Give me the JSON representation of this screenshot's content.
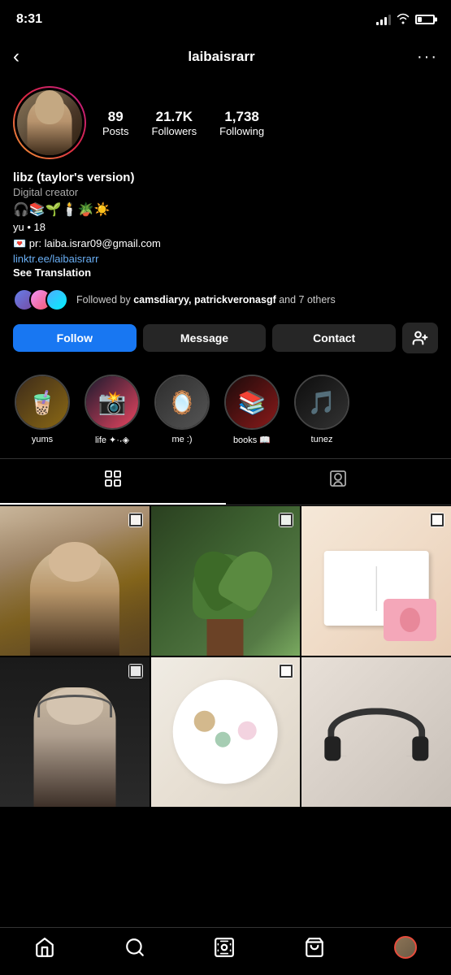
{
  "status": {
    "time": "8:31"
  },
  "nav": {
    "username": "laibaisrarr",
    "back_label": "‹",
    "more_label": "···"
  },
  "profile": {
    "name": "libz (taylor's version)",
    "category": "Digital creator",
    "emojis": "🎧📚🌱🕯️🪴☀️",
    "bio_line1": "yu • 18",
    "bio_line2": "💌 pr: laiba.israr09@gmail.com",
    "bio_link": "linktr.ee/laibaisrarr",
    "translate_label": "See Translation",
    "stats": {
      "posts": {
        "value": "89",
        "label": "Posts"
      },
      "followers": {
        "value": "21.7K",
        "label": "Followers"
      },
      "following": {
        "value": "1,738",
        "label": "Following"
      }
    },
    "followed_by_text": "Followed by ",
    "followed_by_names": "camsdiaryy, patrickveronasgf",
    "followed_by_others": " and 7 others"
  },
  "buttons": {
    "follow": "Follow",
    "message": "Message",
    "contact": "Contact",
    "add_user": "+"
  },
  "highlights": [
    {
      "label": "yums",
      "emoji": "🧋"
    },
    {
      "label": "life ✦·˖◈",
      "emoji": "📸"
    },
    {
      "label": "me :)",
      "emoji": "🪞"
    },
    {
      "label": "books 📖",
      "emoji": "📚"
    },
    {
      "label": "tunez",
      "emoji": "🎵"
    }
  ],
  "tabs": {
    "grid_label": "grid",
    "tag_label": "tag"
  },
  "bottom_nav": {
    "home": "home",
    "search": "search",
    "reels": "reels",
    "shop": "shop",
    "profile": "profile"
  }
}
